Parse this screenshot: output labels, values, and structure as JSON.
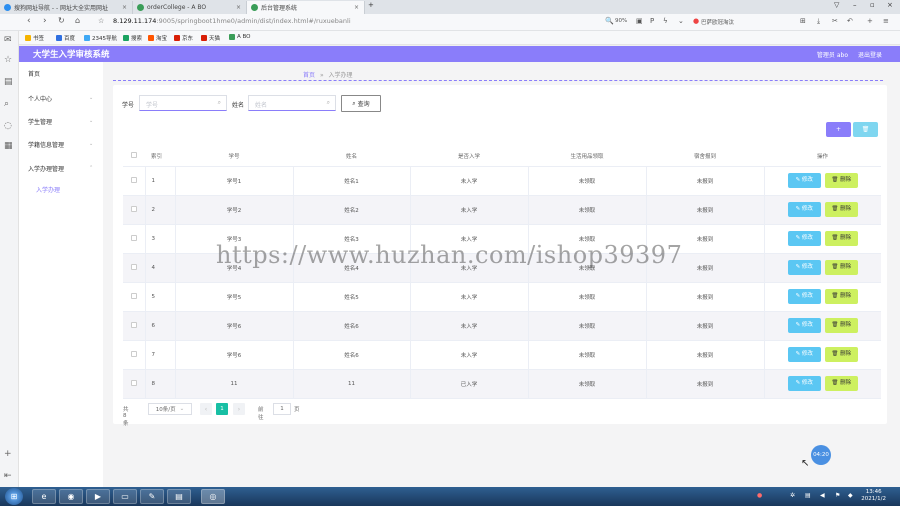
{
  "browser": {
    "tabs": [
      {
        "label": "搜狗网址导航 - - 网址大全实用网址",
        "favicon_color": "#2b8ef0"
      },
      {
        "label": "orderCollege - A BO",
        "favicon_color": "#3a9d58"
      },
      {
        "label": "后台管理系统",
        "favicon_color": "#3a9d58"
      }
    ],
    "url_host": "8.129.11.174",
    "url_path": ":9005/springboot1hme0/admin/dist/index.html#/ruxuebanli",
    "zoom": "90%",
    "search_hint": "巴萨欧冠淘汰",
    "bookmarks": [
      {
        "label": "书签",
        "color": "#f5b400"
      },
      {
        "label": "百度",
        "color": "#2f6fe0"
      },
      {
        "label": "2345导航",
        "color": "#3fa9f5"
      },
      {
        "label": "搜索",
        "color": "#1aa260"
      },
      {
        "label": "淘宝",
        "color": "#ff5500"
      },
      {
        "label": "京东",
        "color": "#d81e06"
      },
      {
        "label": "天猫",
        "color": "#d81e06"
      },
      {
        "label": "A BO",
        "color": "#3a9d58"
      }
    ]
  },
  "app": {
    "title": "大学生入学审核系统",
    "admin_label": "管理员 abo",
    "logout_label": "退出登录",
    "accent": "#8a7dfa"
  },
  "menu": {
    "items": [
      {
        "label": "首页"
      },
      {
        "label": "个人中心"
      },
      {
        "label": "学生管理"
      },
      {
        "label": "学籍信息管理"
      },
      {
        "label": "入学办理管理"
      }
    ],
    "sub_item": "入学办理"
  },
  "breadcrumb": {
    "home": "首页",
    "sep": "»",
    "current": "入学办理"
  },
  "search": {
    "field1_label": "学号",
    "field1_placeholder": "学号",
    "field2_label": "姓名",
    "field2_placeholder": "姓名",
    "button_label": "查询"
  },
  "actions": {
    "add_label": "+",
    "delete_label": "🗑"
  },
  "table": {
    "headers": [
      "索引",
      "学号",
      "姓名",
      "是否入学",
      "生活用品领取",
      "宿舍报到",
      "操作"
    ],
    "edit_label": "修改",
    "delete_label": "删除",
    "rows": [
      {
        "index": "1",
        "student_id": "学号1",
        "name": "姓名1",
        "enrolled": "未入学",
        "supplies": "未领取",
        "dorm": "未报到"
      },
      {
        "index": "2",
        "student_id": "学号2",
        "name": "姓名2",
        "enrolled": "未入学",
        "supplies": "未领取",
        "dorm": "未报到"
      },
      {
        "index": "3",
        "student_id": "学号3",
        "name": "姓名3",
        "enrolled": "未入学",
        "supplies": "未领取",
        "dorm": "未报到"
      },
      {
        "index": "4",
        "student_id": "学号4",
        "name": "姓名4",
        "enrolled": "未入学",
        "supplies": "未领取",
        "dorm": "未报到"
      },
      {
        "index": "5",
        "student_id": "学号5",
        "name": "姓名5",
        "enrolled": "未入学",
        "supplies": "未领取",
        "dorm": "未报到"
      },
      {
        "index": "6",
        "student_id": "学号6",
        "name": "姓名6",
        "enrolled": "未入学",
        "supplies": "未领取",
        "dorm": "未报到"
      },
      {
        "index": "7",
        "student_id": "学号6",
        "name": "姓名6",
        "enrolled": "未入学",
        "supplies": "未领取",
        "dorm": "未报到"
      },
      {
        "index": "8",
        "student_id": "11",
        "name": "11",
        "enrolled": "已入学",
        "supplies": "未领取",
        "dorm": "未报到"
      }
    ]
  },
  "pager": {
    "total": "共 8 条",
    "page_size": "10条/页",
    "current_page": "1",
    "goto_label": "前往",
    "goto_value": "1",
    "page_suffix": "页"
  },
  "watermark": "https://www.huzhan.com/ishop39397",
  "float_label": "04:20",
  "taskbar": {
    "time": "13:46",
    "date": "2021/1/2"
  }
}
